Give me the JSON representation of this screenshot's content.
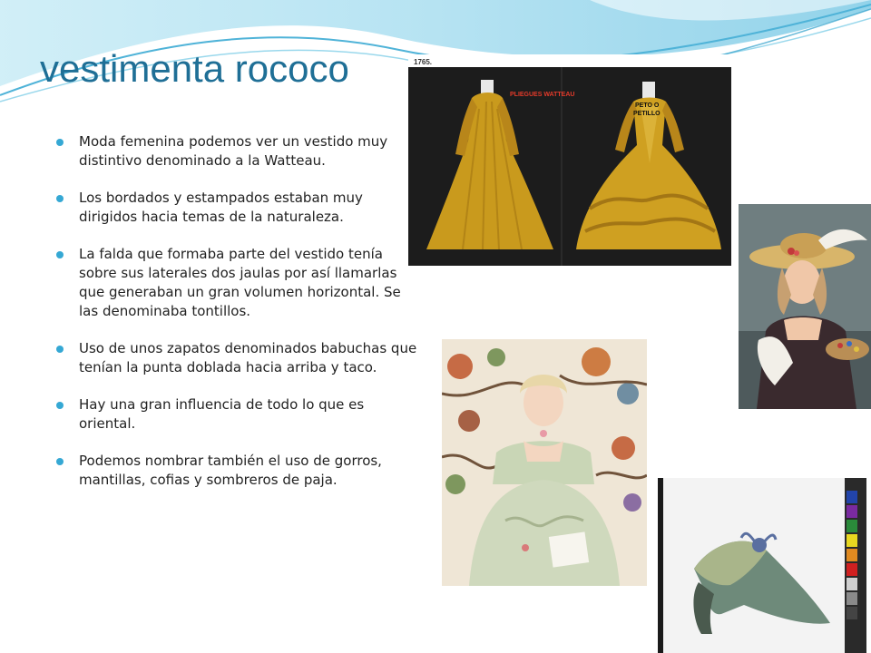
{
  "slide": {
    "title": "vestimenta rococo",
    "bullets": [
      "Moda femenina podemos ver un vestido muy distintivo denominado a la Watteau.",
      "Los bordados y estampados estaban muy dirigidos hacia temas de la naturaleza.",
      "La falda que formaba parte del vestido tenía sobre sus laterales dos jaulas por así llamarlas que generaban un gran volumen horizontal. Se las denominaba tontillos.",
      "Uso de unos zapatos denominados babuchas que tenían la punta doblada hacia arriba y taco.",
      "Hay una gran influencia de todo lo que es oriental.",
      "Podemos nombrar también el uso de gorros, mantillas, cofias y sombreros de paja."
    ]
  },
  "images": {
    "dresses": {
      "year_label": "1765.",
      "label_pliegues": "PLIEGUES WATTEAU",
      "label_peto_line1": "PETO O",
      "label_peto_line2": "PETILLO"
    }
  },
  "colors": {
    "title": "#1f6f96",
    "bullet": "#35a8d4",
    "header_wave": "#8fd3ea"
  }
}
